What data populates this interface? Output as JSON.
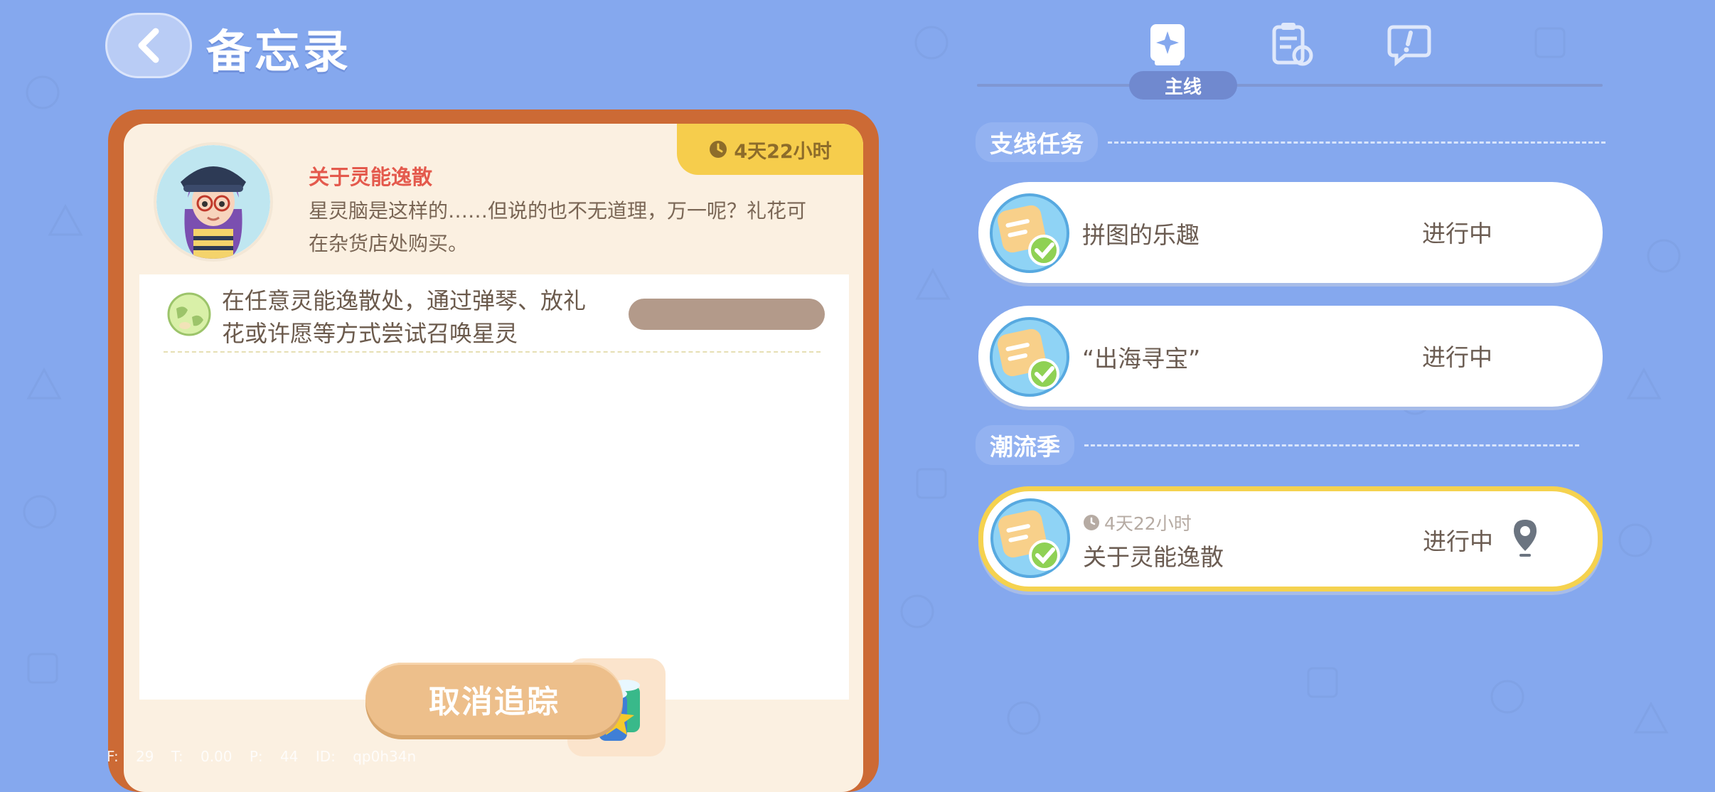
{
  "header": {
    "title": "备忘录"
  },
  "tabs": [
    {
      "id": "main",
      "label": "主线",
      "icon": "book-star-icon",
      "active": true
    },
    {
      "id": "daily",
      "icon": "clipboard-refresh-icon",
      "active": false
    },
    {
      "id": "chat",
      "icon": "chat-exclamation-icon",
      "active": false
    }
  ],
  "detail": {
    "timer": "4天22小时",
    "title": "关于灵能逸散",
    "description": "星灵脑是这样的……但说的也不无道理，万一呢？礼花可在杂货店处购买。",
    "task": "在任意灵能逸散处，通过弹琴、放礼花或许愿等方式尝试召唤星灵",
    "reward_icon": "firework-bundle-icon",
    "cancel_button": "取消追踪"
  },
  "sections": {
    "side": "支线任务",
    "season": "潮流季"
  },
  "quests": [
    {
      "name": "拼图的乐趣",
      "status": "进行中"
    },
    {
      "name": "“出海寻宝”",
      "status": "进行中"
    },
    {
      "name": "关于灵能逸散",
      "status": "进行中",
      "timer": "4天22小时",
      "selected": true
    }
  ],
  "debug": "F: 29  T: 0.00  P: 44  ID: qp0h34n",
  "colors": {
    "background": "#85a8ee",
    "panel_border": "#cc6a35",
    "timer_tab": "#f6cd4c",
    "selected_outline": "#f5d24f",
    "quest_title": "#e45a4d",
    "cancel_button": "#edbf8b"
  }
}
